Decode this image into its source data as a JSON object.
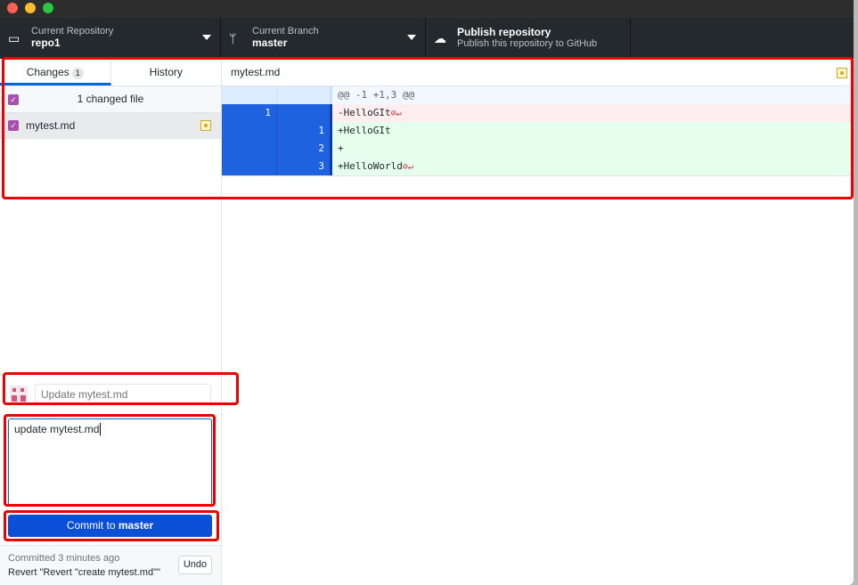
{
  "toolbar": {
    "repository": {
      "label": "Current Repository",
      "value": "repo1",
      "icon": "desktop-icon"
    },
    "branch": {
      "label": "Current Branch",
      "value": "master",
      "icon": "git-branch-icon"
    },
    "publish": {
      "label": "Publish repository",
      "description": "Publish this repository to GitHub",
      "icon": "cloud-upload-icon"
    }
  },
  "sidebar": {
    "tabs": [
      {
        "label": "Changes",
        "count": "1",
        "active": true
      },
      {
        "label": "History"
      }
    ],
    "changed_header": "1 changed file",
    "files": [
      {
        "name": "mytest.md",
        "status": "modified",
        "checked": true
      }
    ]
  },
  "diff": {
    "filename": "mytest.md",
    "lines": [
      {
        "old": "",
        "new": "",
        "text": "@@ -1 +1,3 @@",
        "type": "hunk"
      },
      {
        "old": "1",
        "new": "",
        "text": "-HelloGIt",
        "type": "del",
        "ws": "⊘↵"
      },
      {
        "old": "",
        "new": "1",
        "text": "+HelloGIt",
        "type": "add"
      },
      {
        "old": "",
        "new": "2",
        "text": "+",
        "type": "add"
      },
      {
        "old": "",
        "new": "3",
        "text": "+HelloWorld",
        "type": "add",
        "ws": "⊘↵"
      }
    ]
  },
  "commit": {
    "summary_placeholder": "Update mytest.md",
    "description": "update mytest.md",
    "button_prefix": "Commit to ",
    "button_branch": "master",
    "last_commit_time": "Committed 3 minutes ago",
    "last_commit_message": "Revert \"Revert \"create mytest.md\"\"",
    "undo_label": "Undo"
  },
  "colors": {
    "accent": "#0366d6",
    "commit_button": "#0b4fd6",
    "annotation": "#e00000",
    "add_bg": "#e6ffed",
    "del_bg": "#ffeef0",
    "hunk_bg": "#f1f8ff"
  }
}
